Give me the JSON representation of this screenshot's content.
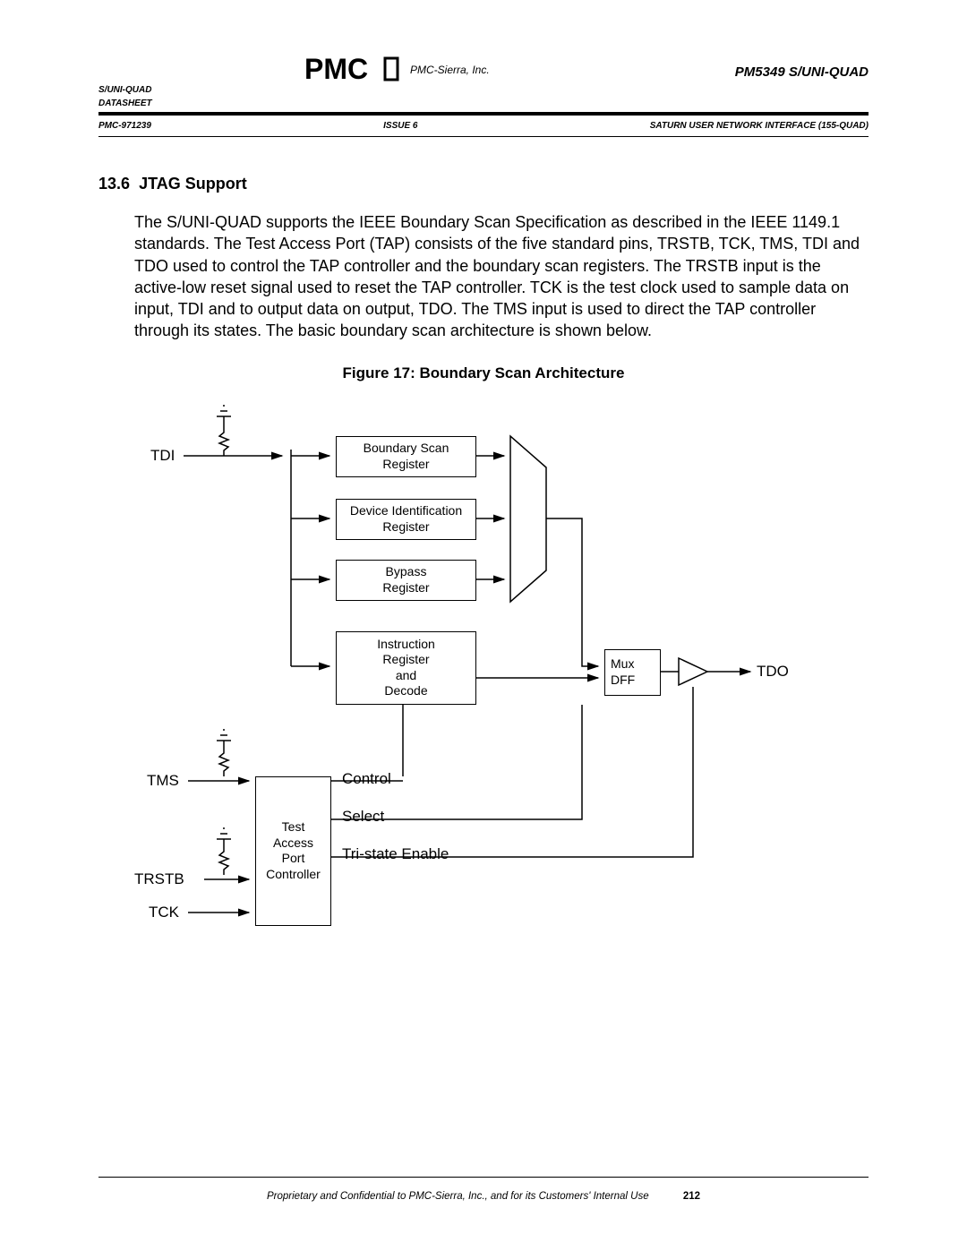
{
  "header": {
    "company": "PMC-Sierra, Inc.",
    "product": "PM5349 S/UNI-QUAD",
    "docline1": "S/UNI-QUAD",
    "docline2": "DATASHEET",
    "docnum": "PMC-971239",
    "issue": "ISSUE 6",
    "subtitle": "SATURN USER NETWORK INTERFACE (155-QUAD)"
  },
  "section": {
    "num": "13.6",
    "title": "JTAG Support"
  },
  "paragraph": "The S/UNI-QUAD supports the IEEE Boundary Scan Specification as described in the IEEE 1149.1 standards.  The Test Access Port (TAP) consists of the five standard pins, TRSTB, TCK, TMS, TDI and TDO used to control the TAP controller and the boundary scan registers.  The TRSTB input is the active-low reset signal used to reset the TAP controller.  TCK is the test clock used to sample data on input, TDI and to output data on output, TDO.  The TMS input is used to direct the TAP controller through its states.  The basic boundary scan architecture is shown below.",
  "figure": {
    "caption": "Figure 17:  Boundary Scan Architecture"
  },
  "diagram": {
    "inputs": {
      "tdi": "TDI",
      "tms": "TMS",
      "trstb": "TRSTB",
      "tck": "TCK"
    },
    "boxes": {
      "bsr": "Boundary Scan\nRegister",
      "dir": "Device Identification\nRegister",
      "byp": "Bypass\nRegister",
      "ird": "Instruction\nRegister\nand\nDecode",
      "tap": "Test\nAccess\nPort\nController",
      "mux": "Mux\nDFF"
    },
    "signals": {
      "ctrl": "Control",
      "sel": "Select",
      "tse": "Tri-state Enable"
    },
    "output": "TDO"
  },
  "footer": {
    "text": "Proprietary and Confidential to PMC-Sierra, Inc., and for its Customers' Internal Use",
    "page": "212"
  }
}
